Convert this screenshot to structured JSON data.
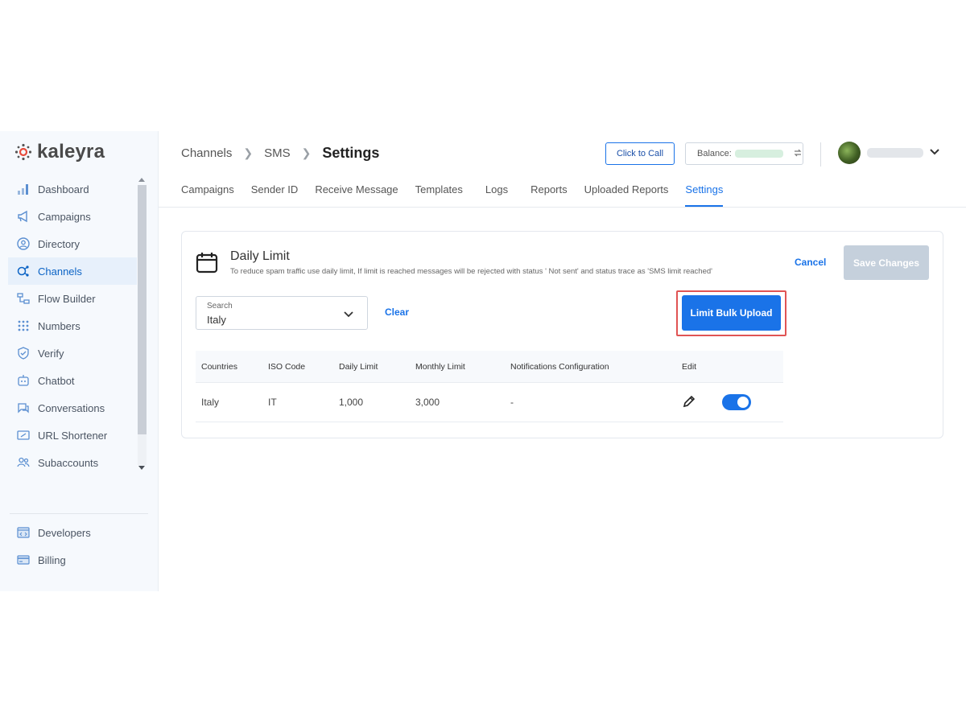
{
  "brand": {
    "name": "kaleyra"
  },
  "colors": {
    "accent": "#1a73e8",
    "sidebar_bg": "#f6f9fd",
    "active_nav_bg": "#e7f0fb",
    "highlight_border": "#e05454",
    "disabled_button": "#c5d0dc"
  },
  "sidebar": {
    "items": [
      {
        "label": "Dashboard",
        "icon": "bar-chart-icon"
      },
      {
        "label": "Campaigns",
        "icon": "megaphone-icon"
      },
      {
        "label": "Directory",
        "icon": "contact-icon"
      },
      {
        "label": "Channels",
        "icon": "channels-icon",
        "active": true
      },
      {
        "label": "Flow Builder",
        "icon": "flow-icon"
      },
      {
        "label": "Numbers",
        "icon": "keypad-icon"
      },
      {
        "label": "Verify",
        "icon": "shield-icon"
      },
      {
        "label": "Chatbot",
        "icon": "bot-icon"
      },
      {
        "label": "Conversations",
        "icon": "chat-icon"
      },
      {
        "label": "URL Shortener",
        "icon": "link-icon"
      },
      {
        "label": "Subaccounts",
        "icon": "users-icon"
      }
    ],
    "bottom_items": [
      {
        "label": "Developers",
        "icon": "code-icon"
      },
      {
        "label": "Billing",
        "icon": "card-icon"
      }
    ]
  },
  "header": {
    "breadcrumb": [
      "Channels",
      "SMS",
      "Settings"
    ],
    "click_to_call": "Click to Call",
    "balance_label": "Balance:"
  },
  "tabs": [
    "Campaigns",
    "Sender ID",
    "Receive Message",
    "Templates",
    "Logs",
    "Reports",
    "Uploaded Reports",
    "Settings"
  ],
  "active_tab": "Settings",
  "card": {
    "title": "Daily Limit",
    "description": "To reduce spam traffic use daily limit, If limit is reached messages will be rejected with status ' Not sent' and status trace as 'SMS limit reached'",
    "cancel": "Cancel",
    "save": "Save Changes",
    "search": {
      "label": "Search",
      "value": "Italy"
    },
    "clear": "Clear",
    "bulk_upload": "Limit Bulk Upload"
  },
  "table": {
    "headers": [
      "Countries",
      "ISO Code",
      "Daily Limit",
      "Monthly Limit",
      "Notifications Configuration",
      "Edit"
    ],
    "rows": [
      {
        "country": "Italy",
        "iso": "IT",
        "daily": "1,000",
        "monthly": "3,000",
        "notifications": "-",
        "enabled": true
      }
    ]
  }
}
